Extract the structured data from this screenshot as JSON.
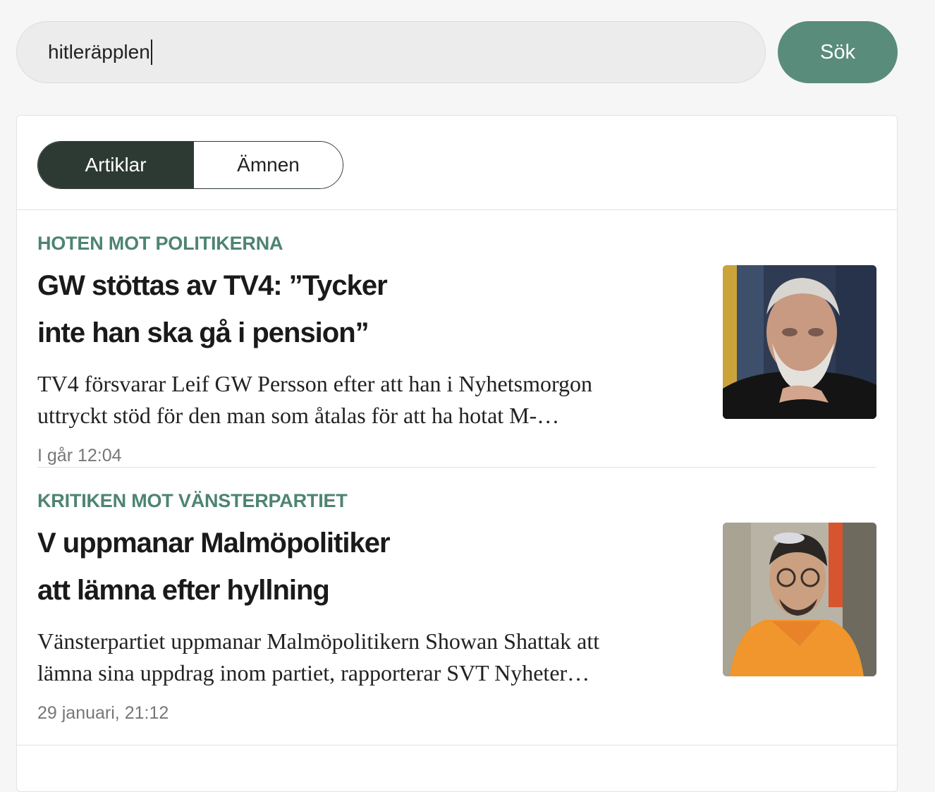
{
  "search": {
    "value": "hitleräpplen",
    "button_label": "Sök"
  },
  "tabs": {
    "active": "Artiklar",
    "inactive": "Ämnen"
  },
  "articles": [
    {
      "kicker": "HOTEN MOT POLITIKERNA",
      "headline_line1": "GW stöttas av TV4: ”Tycker",
      "headline_line2": "inte han ska gå i pension”",
      "summary_line1": "TV4 försvarar Leif GW Persson efter att han i Nyhetsmorgon",
      "summary_line2": "uttryckt stöd för den man som åtalas för att ha hotat M-…",
      "date": "I går 12:04"
    },
    {
      "kicker": "KRITIKEN MOT VÄNSTERPARTIET",
      "headline_line1": "V uppmanar Malmöpolitiker",
      "headline_line2": "att lämna efter hyllning",
      "summary_line1": "Vänsterpartiet uppmanar Malmöpolitikern Showan Shattak att",
      "summary_line2": "lämna sina uppdrag inom partiet, rapporterar SVT Nyheter…",
      "date": "29 januari, 21:12"
    }
  ],
  "colors": {
    "accent": "#5a8c7b",
    "kicker": "#4e8471",
    "toggle_dark": "#2d3a33"
  }
}
